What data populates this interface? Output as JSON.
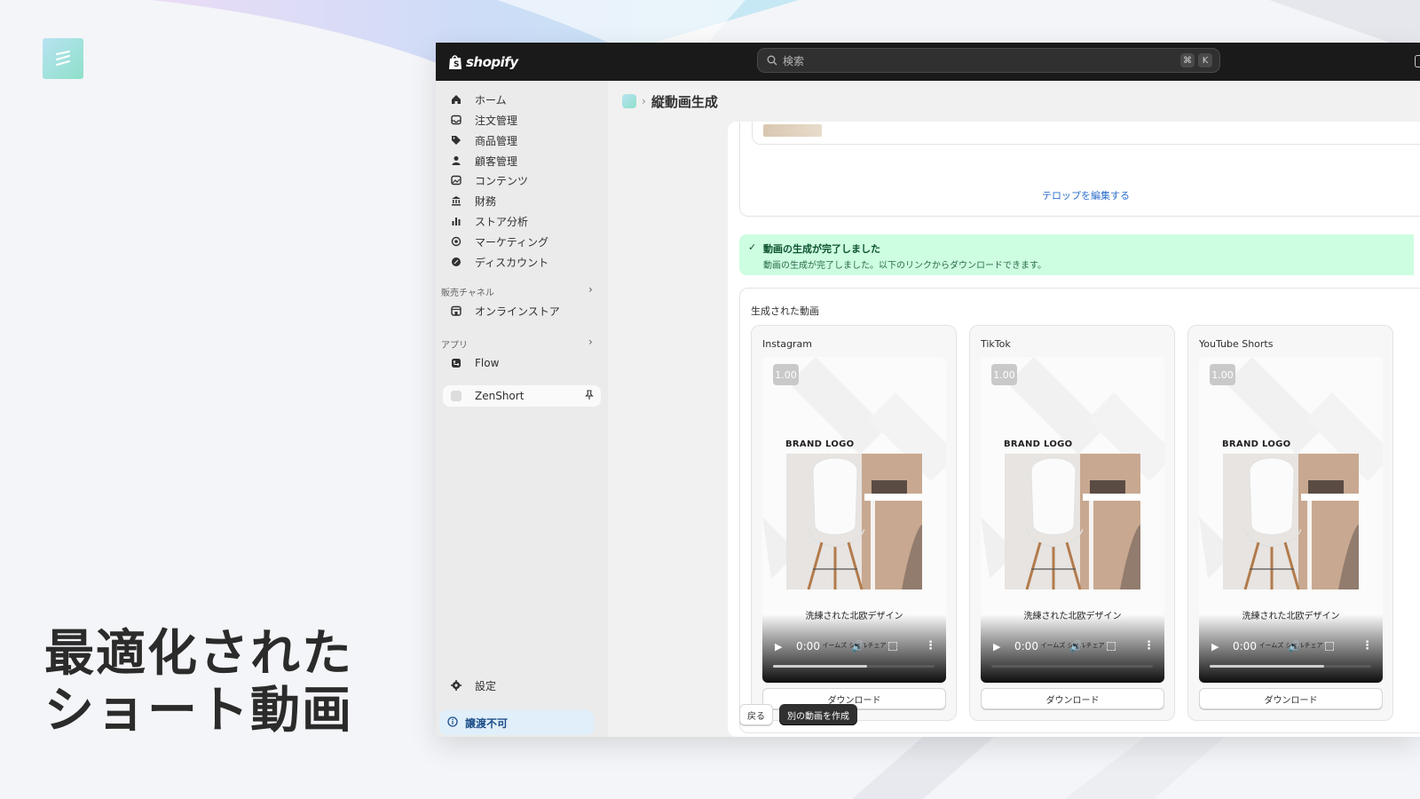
{
  "hero": {
    "line1": "最適化された",
    "line2": "ショート動画"
  },
  "topbar": {
    "brand": "shopify",
    "search_placeholder": "検索",
    "shortcut_cmd": "⌘",
    "shortcut_key": "K"
  },
  "sidebar": {
    "items": [
      {
        "label": "ホーム",
        "icon": "home-icon"
      },
      {
        "label": "注文管理",
        "icon": "inbox-icon"
      },
      {
        "label": "商品管理",
        "icon": "tag-icon"
      },
      {
        "label": "顧客管理",
        "icon": "person-icon"
      },
      {
        "label": "コンテンツ",
        "icon": "image-icon"
      },
      {
        "label": "財務",
        "icon": "bank-icon"
      },
      {
        "label": "ストア分析",
        "icon": "chart-icon"
      },
      {
        "label": "マーケティング",
        "icon": "target-icon"
      },
      {
        "label": "ディスカウント",
        "icon": "discount-icon"
      }
    ],
    "sales_channels_label": "販売チャネル",
    "online_store": "オンラインストア",
    "apps_label": "アプリ",
    "flow": "Flow",
    "zenshort": "ZenShort",
    "settings": "設定",
    "non_transferable": "譲渡不可"
  },
  "page": {
    "title": "縦動画生成",
    "edit_captions_link": "テロップを編集する",
    "success_title": "動画の生成が完了しました",
    "success_body": "動画の生成が完了しました。以下のリンクからダウンロードできます。",
    "generated_videos_heading": "生成された動画",
    "back_button": "戻る",
    "create_another_button": "別の動画を作成"
  },
  "videos": [
    {
      "platform": "Instagram",
      "rate": "1.00",
      "brand": "BRAND LOGO",
      "caption": "洗練された北欧デザイン",
      "subcaption": "イームズ シェルチェア",
      "time": "0:00",
      "progress": 0.58,
      "download": "ダウンロード"
    },
    {
      "platform": "TikTok",
      "rate": "1.00",
      "brand": "BRAND LOGO",
      "caption": "洗練された北欧デザイン",
      "subcaption": "イームズ シェルチェア",
      "time": "0:00",
      "progress": 0.0,
      "download": "ダウンロード"
    },
    {
      "platform": "YouTube Shorts",
      "rate": "1.00",
      "brand": "BRAND LOGO",
      "caption": "洗練された北欧デザイン",
      "subcaption": "イームズ シェルチェア",
      "time": "0:00",
      "progress": 0.71,
      "download": "ダウンロード"
    }
  ],
  "colors": {
    "accent_green_bg": "#cdfee1",
    "link_blue": "#2c6ecb",
    "topbar": "#1a1a1a",
    "primary_button": "#303030"
  }
}
